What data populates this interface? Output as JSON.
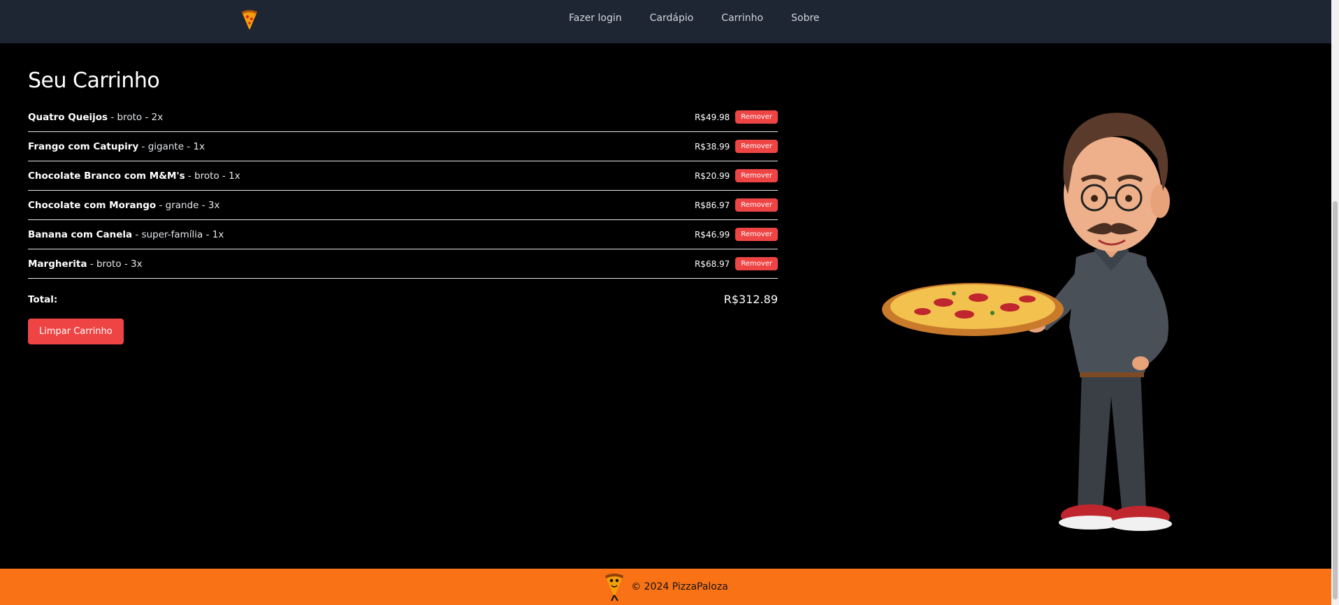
{
  "nav": {
    "logo": "pizza-slice-icon",
    "links": [
      "Fazer login",
      "Cardápio",
      "Carrinho",
      "Sobre"
    ]
  },
  "cart": {
    "title": "Seu Carrinho",
    "items": [
      {
        "name": "Quatro Queijos",
        "meta": " - broto - 2x",
        "price": "R$49.98",
        "remove": "Remover"
      },
      {
        "name": "Frango com Catupiry",
        "meta": " - gigante - 1x",
        "price": "R$38.99",
        "remove": "Remover"
      },
      {
        "name": "Chocolate Branco com M&M's",
        "meta": " - broto - 1x",
        "price": "R$20.99",
        "remove": "Remover"
      },
      {
        "name": "Chocolate com Morango",
        "meta": " - grande - 3x",
        "price": "R$86.97",
        "remove": "Remover"
      },
      {
        "name": "Banana com Canela",
        "meta": " - super-família - 1x",
        "price": "R$46.99",
        "remove": "Remover"
      },
      {
        "name": "Margherita",
        "meta": " - broto - 3x",
        "price": "R$68.97",
        "remove": "Remover"
      }
    ],
    "total_label": "Total:",
    "total_value": "R$312.89",
    "clear_label": "Limpar Carrinho"
  },
  "footer": {
    "text": "© 2024 PizzaPaloza"
  },
  "colors": {
    "navbar": "#1e2533",
    "accent": "#f97316",
    "danger": "#ef4444"
  }
}
